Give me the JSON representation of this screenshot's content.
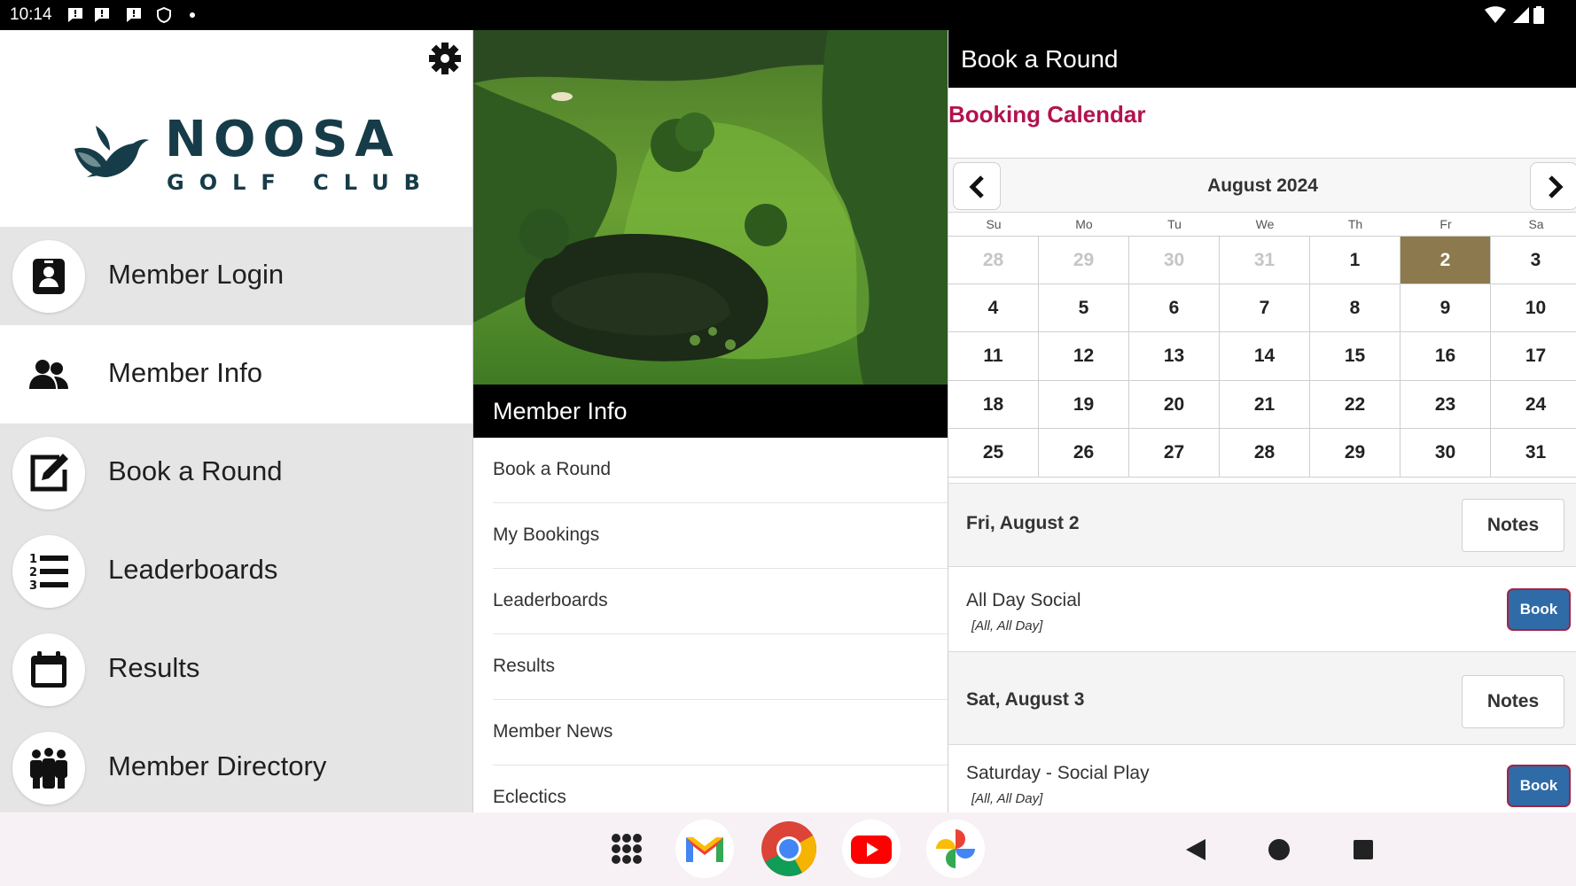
{
  "status_bar": {
    "time": "10:14",
    "icons": [
      "message-icon",
      "message-icon",
      "message-icon",
      "shield-icon",
      "dot-icon"
    ],
    "right_icons": [
      "wifi-icon",
      "signal-icon",
      "battery-icon"
    ]
  },
  "left_nav": {
    "logo": {
      "name": "NOOSA",
      "subtitle": "GOLF CLUB"
    },
    "items": [
      {
        "label": "Member Login",
        "icon": "member-login-icon",
        "active": false
      },
      {
        "label": "Member Info",
        "icon": "members-icon",
        "active": true
      },
      {
        "label": "Book a Round",
        "icon": "edit-icon",
        "active": false
      },
      {
        "label": "Leaderboards",
        "icon": "numbered-list-icon",
        "active": false
      },
      {
        "label": "Results",
        "icon": "calendar-icon",
        "active": false
      },
      {
        "label": "Member Directory",
        "icon": "group-icon",
        "active": false
      }
    ]
  },
  "middle": {
    "title": "Member Info",
    "items": [
      {
        "label": "Book a Round"
      },
      {
        "label": "My Bookings"
      },
      {
        "label": "Leaderboards"
      },
      {
        "label": "Results"
      },
      {
        "label": "Member News"
      },
      {
        "label": "Eclectics"
      }
    ]
  },
  "booking": {
    "header_title": "Book a Round",
    "section_title": "Booking Calendar",
    "month": "August 2024",
    "weekdays": [
      "Su",
      "Mo",
      "Tu",
      "We",
      "Th",
      "Fr",
      "Sa"
    ],
    "weeks": [
      [
        {
          "d": "28",
          "out": true
        },
        {
          "d": "29",
          "out": true
        },
        {
          "d": "30",
          "out": true
        },
        {
          "d": "31",
          "out": true
        },
        {
          "d": "1"
        },
        {
          "d": "2",
          "selected": true
        },
        {
          "d": "3"
        }
      ],
      [
        {
          "d": "4"
        },
        {
          "d": "5"
        },
        {
          "d": "6"
        },
        {
          "d": "7"
        },
        {
          "d": "8"
        },
        {
          "d": "9"
        },
        {
          "d": "10"
        }
      ],
      [
        {
          "d": "11"
        },
        {
          "d": "12"
        },
        {
          "d": "13"
        },
        {
          "d": "14"
        },
        {
          "d": "15"
        },
        {
          "d": "16"
        },
        {
          "d": "17"
        }
      ],
      [
        {
          "d": "18"
        },
        {
          "d": "19"
        },
        {
          "d": "20"
        },
        {
          "d": "21"
        },
        {
          "d": "22"
        },
        {
          "d": "23"
        },
        {
          "d": "24"
        }
      ],
      [
        {
          "d": "25"
        },
        {
          "d": "26"
        },
        {
          "d": "27"
        },
        {
          "d": "28"
        },
        {
          "d": "29"
        },
        {
          "d": "30"
        },
        {
          "d": "31"
        }
      ]
    ],
    "days": [
      {
        "label": "Fri, August 2",
        "notes_label": "Notes",
        "event": {
          "name": "All Day Social",
          "detail": "[All, All Day]",
          "book_label": "Book"
        }
      },
      {
        "label": "Sat, August 3",
        "notes_label": "Notes",
        "event": {
          "name": "Saturday - Social Play",
          "detail": "[All, All Day]",
          "book_label": "Book"
        }
      }
    ]
  },
  "dock": {
    "apps": [
      "app-drawer-icon",
      "gmail-icon",
      "chrome-icon",
      "youtube-icon",
      "photos-icon"
    ],
    "system": [
      "back-icon",
      "home-icon",
      "recents-icon"
    ]
  },
  "colors": {
    "accent": "#b3124e",
    "selected_day": "#8c7a4e",
    "book_button": "#2f6ba7",
    "logo": "#173c49"
  }
}
